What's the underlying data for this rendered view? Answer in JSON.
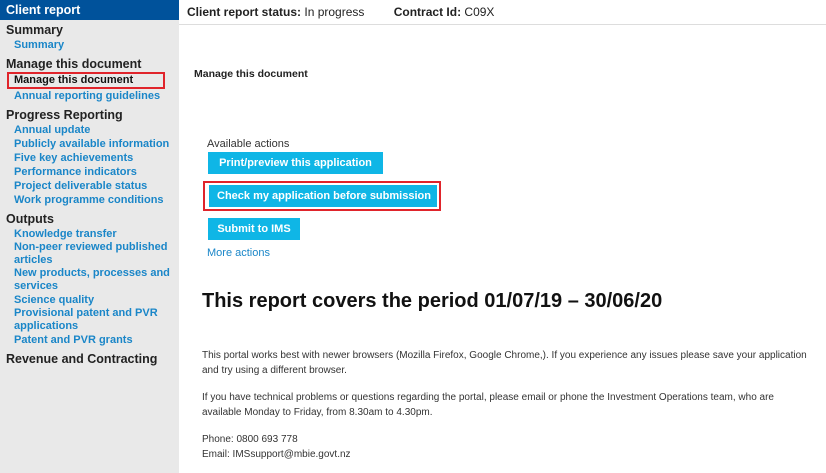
{
  "sidebar": {
    "header": "Client report",
    "sections": [
      {
        "title": "Summary",
        "items": [
          {
            "label": "Summary"
          }
        ]
      },
      {
        "title": "Manage this document",
        "items": [
          {
            "label": "Manage this document",
            "active": true
          },
          {
            "label": "Annual reporting guidelines"
          }
        ]
      },
      {
        "title": "Progress Reporting",
        "items": [
          {
            "label": "Annual update"
          },
          {
            "label": "Publicly available information"
          },
          {
            "label": "Five key achievements"
          },
          {
            "label": "Performance indicators"
          },
          {
            "label": "Project deliverable status"
          },
          {
            "label": "Work programme conditions"
          }
        ]
      },
      {
        "title": "Outputs",
        "items": [
          {
            "label": "Knowledge transfer"
          },
          {
            "label": "Non-peer reviewed published articles"
          },
          {
            "label": "New products, processes and services"
          },
          {
            "label": "Science quality"
          },
          {
            "label": "Provisional patent and PVR applications"
          },
          {
            "label": "Patent and PVR grants"
          }
        ]
      },
      {
        "title": "Revenue and Contracting",
        "items": []
      }
    ]
  },
  "topbar": {
    "status_label": "Client report status:",
    "status_value": "In progress",
    "contract_label": "Contract Id:",
    "contract_value": "C09X"
  },
  "main": {
    "doc_title": "Manage this document",
    "available_actions_label": "Available actions",
    "buttons": {
      "print": "Print/preview this application",
      "check": "Check my application before submission",
      "submit": "Submit to IMS"
    },
    "more_actions": "More actions",
    "period_heading": "This report covers the period 01/07/19 – 30/06/20",
    "para1": "This portal works best with newer browsers (Mozilla Firefox, Google Chrome,). If you experience any issues please save your application and try using a different browser.",
    "para2": "If you have technical problems or questions regarding the portal, please email or phone the Investment Operations team, who are available Monday to Friday, from 8.30am to 4.30pm.",
    "phone": "Phone: 0800 693 778",
    "email": "Email: IMSsupport@mbie.govt.nz"
  },
  "colors": {
    "brand": "#00529b",
    "button": "#0fb6e6",
    "link": "#1a86c8",
    "highlight": "#e0242b",
    "sidebar_bg": "#e9e9e9"
  }
}
